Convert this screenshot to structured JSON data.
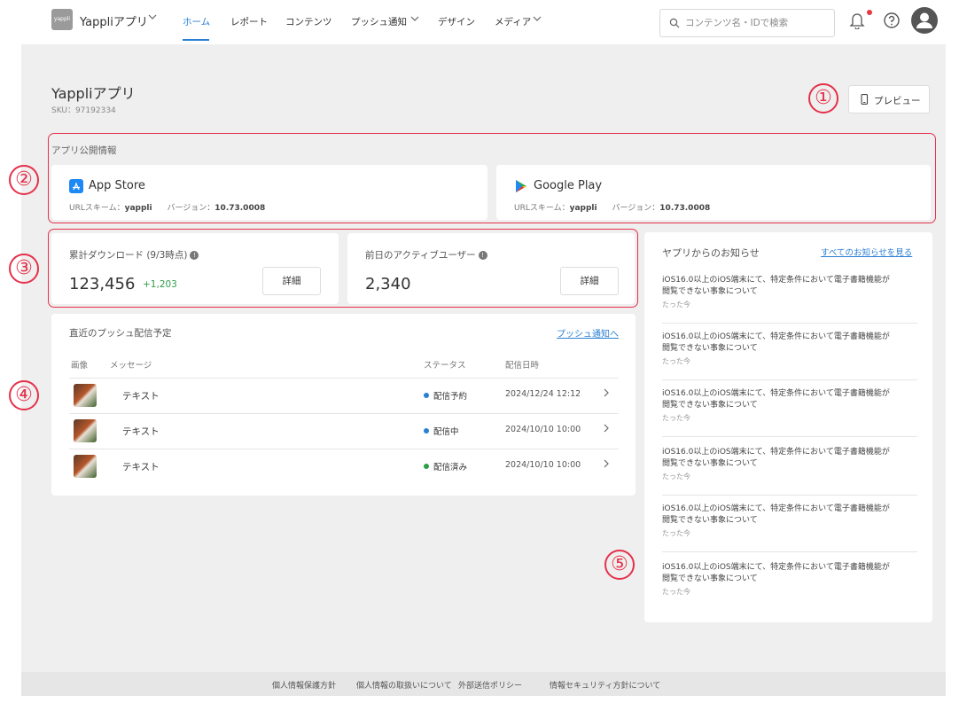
{
  "header": {
    "logo_text": "yappli",
    "app_name": "Yappliアプリ",
    "nav": [
      "ホーム",
      "レポート",
      "コンテンツ",
      "プッシュ通知",
      "デザイン",
      "メディア"
    ],
    "search_placeholder": "コンテンツ名・IDで検索"
  },
  "page": {
    "title": "Yappliアプリ",
    "sku": "SKU：97192334",
    "preview_label": "プレビュー"
  },
  "publish": {
    "section_label": "アプリ公開情報",
    "app_store": {
      "name": "App Store",
      "scheme_label": "URLスキーム：",
      "scheme": "yappli",
      "version_label": "バージョン：",
      "version": "10.73.0008"
    },
    "google_play": {
      "name": "Google Play",
      "scheme_label": "URLスキーム：",
      "scheme": "yappli",
      "version_label": "バージョン：",
      "version": "10.73.0008"
    }
  },
  "stats": {
    "downloads": {
      "label": "累計ダウンロード (9/3時点)",
      "value": "123,456",
      "delta": "+1,203",
      "button": "詳細"
    },
    "active": {
      "label": "前日のアクティブユーザー",
      "value": "2,340",
      "button": "詳細"
    }
  },
  "push": {
    "title": "直近のプッシュ配信予定",
    "link": "プッシュ通知へ",
    "headers": [
      "画像",
      "メッセージ",
      "ステータス",
      "配信日時"
    ],
    "rows": [
      {
        "message": "テキスト",
        "status": "配信予約",
        "status_color": "#2a7fd4",
        "date": "2024/12/24 12:12"
      },
      {
        "message": "テキスト",
        "status": "配信中",
        "status_color": "#2a7fd4",
        "date": "2024/10/10 10:00"
      },
      {
        "message": "テキスト",
        "status": "配信済み",
        "status_color": "#2e9d4a",
        "date": "2024/10/10 10:00"
      }
    ]
  },
  "news": {
    "title": "ヤプリからのお知らせ",
    "link": "すべてのお知らせを見る",
    "items": [
      {
        "line1": "iOS16.0以上のiOS端末にて、特定条件において電子書籍機能が",
        "line2": "閲覧できない事象について",
        "time": "たった今"
      },
      {
        "line1": "iOS16.0以上のiOS端末にて、特定条件において電子書籍機能が",
        "line2": "閲覧できない事象について",
        "time": "たった今"
      },
      {
        "line1": "iOS16.0以上のiOS端末にて、特定条件において電子書籍機能が",
        "line2": "閲覧できない事象について",
        "time": "たった今"
      },
      {
        "line1": "iOS16.0以上のiOS端末にて、特定条件において電子書籍機能が",
        "line2": "閲覧できない事象について",
        "time": "たった今"
      },
      {
        "line1": "iOS16.0以上のiOS端末にて、特定条件において電子書籍機能が",
        "line2": "閲覧できない事象について",
        "time": "たった今"
      },
      {
        "line1": "iOS16.0以上のiOS端末にて、特定条件において電子書籍機能が",
        "line2": "閲覧できない事象について",
        "time": "たった今"
      }
    ]
  },
  "annotations": [
    "①",
    "②",
    "③",
    "④",
    "⑤"
  ],
  "footer": [
    "個人情報保護方針",
    "個人情報の取扱いについて",
    "外部送信ポリシー",
    "情報セキュリティ方針について"
  ],
  "colors": {
    "accent": "#2a7fd4",
    "annotation": "#e5314a",
    "success": "#2e9d4a",
    "notification_dot": "#e63946"
  },
  "icons": {
    "search": "search-icon",
    "bell": "bell-icon",
    "help": "help-icon",
    "avatar": "avatar-icon",
    "preview": "phone-icon",
    "app_store": "app-store-icon",
    "google_play": "google-play-icon",
    "info": "info-icon",
    "chevron": "chevron-right-icon"
  }
}
